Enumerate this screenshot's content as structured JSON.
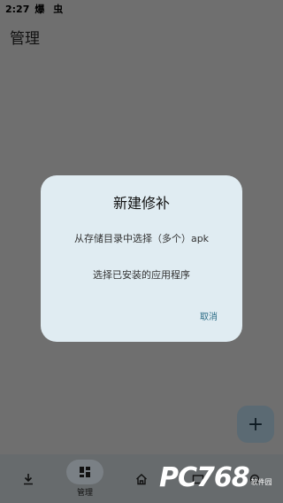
{
  "status_bar": {
    "time": "2:27",
    "icons": "爆 虫"
  },
  "app_bar": {
    "title": "管理"
  },
  "dialog": {
    "title": "新建修补",
    "options": [
      "从存储目录中选择（多个）apk",
      "选择已安装的应用程序"
    ],
    "cancel_label": "取消"
  },
  "fab": {
    "icon": "plus-icon",
    "label": "+"
  },
  "bottom_nav": {
    "items": [
      {
        "icon": "download-icon",
        "label": ""
      },
      {
        "icon": "dashboard-icon",
        "label": "管理",
        "active": true
      },
      {
        "icon": "home-icon",
        "label": ""
      },
      {
        "icon": "folder-icon",
        "label": ""
      },
      {
        "icon": "settings-icon",
        "label": ""
      }
    ]
  },
  "watermark": {
    "text": "PC768",
    "sub": "软件园"
  }
}
